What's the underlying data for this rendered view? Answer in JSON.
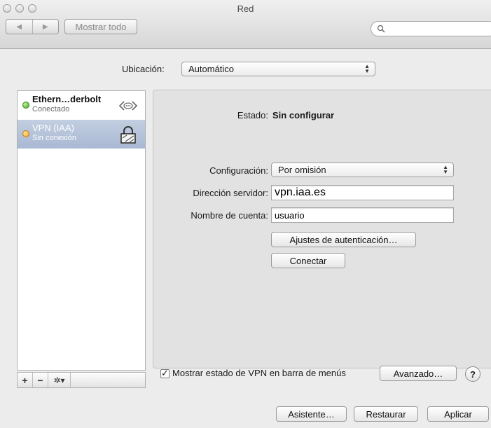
{
  "window": {
    "title": "Red"
  },
  "toolbar": {
    "show_all_label": "Mostrar todo",
    "search_placeholder": ""
  },
  "location": {
    "label": "Ubicación:",
    "value": "Automático"
  },
  "services": [
    {
      "name": "Ethern…derbolt",
      "status": "Conectado",
      "status_color": "#3ba51b",
      "icon": "ethernet-icon"
    },
    {
      "name": "VPN (IAA)",
      "status": "Sin conexión",
      "status_color": "#f1a21c",
      "icon": "lock-icon"
    }
  ],
  "service_toolbar": {
    "add": "+",
    "remove": "−",
    "action": "✲▾"
  },
  "detail": {
    "status_label": "Estado:",
    "status_value": "Sin configurar",
    "configuration_label": "Configuración:",
    "configuration_value": "Por omisión",
    "server_label": "Dirección servidor:",
    "server_value": "vpn.iaa.es",
    "account_label": "Nombre de cuenta:",
    "account_value": "usuario",
    "auth_button": "Ajustes de autenticación…",
    "connect_button": "Conectar",
    "show_vpn_status_label": "Mostrar estado de VPN en barra de menús",
    "show_vpn_status_checked": true,
    "advanced_button": "Avanzado…",
    "help": "?"
  },
  "footer": {
    "assistant_button": "Asistente…",
    "restore_button": "Restaurar",
    "apply_button": "Aplicar"
  },
  "colors": {
    "selection": "#b3c1d9",
    "panel": "#e2e2e2"
  }
}
